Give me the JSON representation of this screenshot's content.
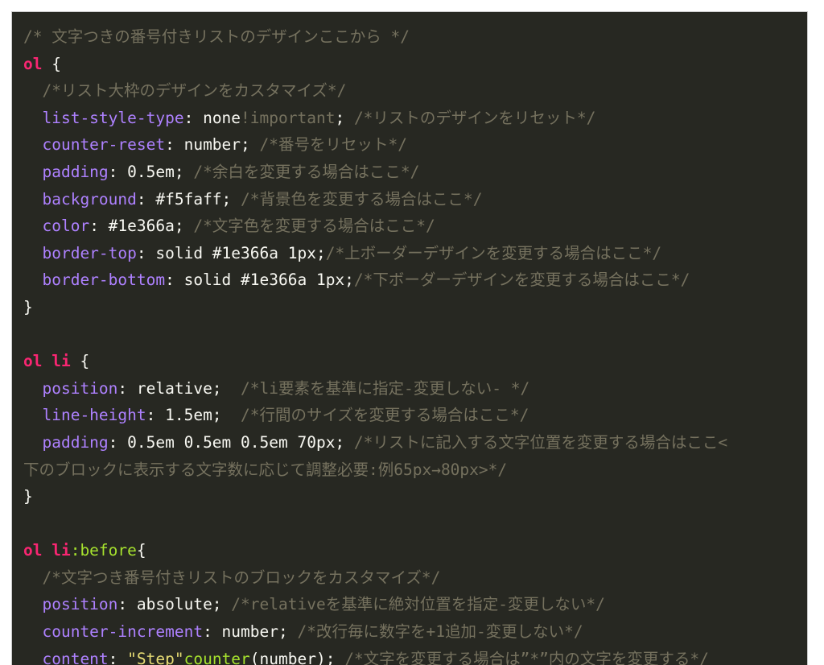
{
  "colors": {
    "background": "#272822",
    "comment": "#75715e",
    "selector": "#f92672",
    "property": "#ae81ff",
    "value": "#f8f8f2",
    "string": "#e6db74",
    "function": "#a6e22e"
  },
  "lines": [
    [
      {
        "t": "/* 文字つきの番号付きリストのデザインここから */",
        "c": "comment"
      }
    ],
    [
      {
        "t": "ol",
        "c": "selector"
      },
      {
        "t": " {",
        "c": "punct"
      }
    ],
    [
      {
        "t": "  /*リスト大枠のデザインをカスタマイズ*/",
        "c": "comment"
      }
    ],
    [
      {
        "t": "  "
      },
      {
        "t": "list-style-type",
        "c": "prop"
      },
      {
        "t": ": none",
        "c": "value"
      },
      {
        "t": "!important",
        "c": "important"
      },
      {
        "t": "; ",
        "c": "punct"
      },
      {
        "t": "/*リストのデザインをリセット*/",
        "c": "comment"
      }
    ],
    [
      {
        "t": "  "
      },
      {
        "t": "counter-reset",
        "c": "prop"
      },
      {
        "t": ": number; ",
        "c": "value"
      },
      {
        "t": "/*番号をリセット*/",
        "c": "comment"
      }
    ],
    [
      {
        "t": "  "
      },
      {
        "t": "padding",
        "c": "prop"
      },
      {
        "t": ": 0.5em; ",
        "c": "value"
      },
      {
        "t": "/*余白を変更する場合はここ*/",
        "c": "comment"
      }
    ],
    [
      {
        "t": "  "
      },
      {
        "t": "background",
        "c": "prop"
      },
      {
        "t": ": #f5faff; ",
        "c": "value"
      },
      {
        "t": "/*背景色を変更する場合はここ*/",
        "c": "comment"
      }
    ],
    [
      {
        "t": "  "
      },
      {
        "t": "color",
        "c": "prop"
      },
      {
        "t": ": #1e366a; ",
        "c": "value"
      },
      {
        "t": "/*文字色を変更する場合はここ*/",
        "c": "comment"
      }
    ],
    [
      {
        "t": "  "
      },
      {
        "t": "border-top",
        "c": "prop"
      },
      {
        "t": ": solid #1e366a 1px;",
        "c": "value"
      },
      {
        "t": "/*上ボーダーデザインを変更する場合はここ*/",
        "c": "comment"
      }
    ],
    [
      {
        "t": "  "
      },
      {
        "t": "border-bottom",
        "c": "prop"
      },
      {
        "t": ": solid #1e366a 1px;",
        "c": "value"
      },
      {
        "t": "/*下ボーダーデザインを変更する場合はここ*/",
        "c": "comment"
      }
    ],
    [
      {
        "t": "}",
        "c": "punct"
      }
    ],
    [],
    [
      {
        "t": "ol li",
        "c": "selector"
      },
      {
        "t": " {",
        "c": "punct"
      }
    ],
    [
      {
        "t": "  "
      },
      {
        "t": "position",
        "c": "prop"
      },
      {
        "t": ": relative;  ",
        "c": "value"
      },
      {
        "t": "/*li要素を基準に指定-変更しない- */",
        "c": "comment"
      }
    ],
    [
      {
        "t": "  "
      },
      {
        "t": "line-height",
        "c": "prop"
      },
      {
        "t": ": 1.5em;  ",
        "c": "value"
      },
      {
        "t": "/*行間のサイズを変更する場合はここ*/",
        "c": "comment"
      }
    ],
    [
      {
        "t": "  "
      },
      {
        "t": "padding",
        "c": "prop"
      },
      {
        "t": ": 0.5em 0.5em 0.5em 70px; ",
        "c": "value"
      },
      {
        "t": "/*リストに記入する文字位置を変更する場合はここ<",
        "c": "comment"
      }
    ],
    [
      {
        "t": "下のブロックに表示する文字数に応じて調整必要:例65px→80px>*/",
        "c": "comment"
      }
    ],
    [
      {
        "t": "}",
        "c": "punct"
      }
    ],
    [],
    [
      {
        "t": "ol li",
        "c": "selector"
      },
      {
        "t": ":before",
        "c": "pseudo"
      },
      {
        "t": "{",
        "c": "punct"
      }
    ],
    [
      {
        "t": "  /*文字つき番号付きリストのブロックをカスタマイズ*/",
        "c": "comment"
      }
    ],
    [
      {
        "t": "  "
      },
      {
        "t": "position",
        "c": "prop"
      },
      {
        "t": ": absolute; ",
        "c": "value"
      },
      {
        "t": "/*relativeを基準に絶対位置を指定-変更しない*/",
        "c": "comment"
      }
    ],
    [
      {
        "t": "  "
      },
      {
        "t": "counter-increment",
        "c": "prop"
      },
      {
        "t": ": number; ",
        "c": "value"
      },
      {
        "t": "/*改行毎に数字を+1追加-変更しない*/",
        "c": "comment"
      }
    ],
    [
      {
        "t": "  "
      },
      {
        "t": "content",
        "c": "prop"
      },
      {
        "t": ": ",
        "c": "value"
      },
      {
        "t": "\"Step\"",
        "c": "string"
      },
      {
        "t": "counter",
        "c": "func"
      },
      {
        "t": "(number); ",
        "c": "value"
      },
      {
        "t": "/*文字を変更する場合は”*”内の文字を変更する*/",
        "c": "comment"
      }
    ]
  ]
}
